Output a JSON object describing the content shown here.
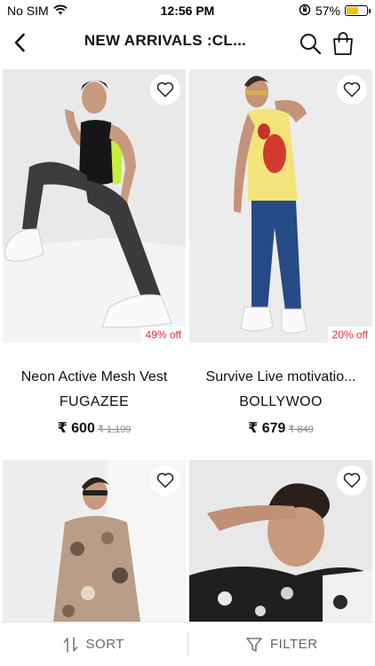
{
  "status_bar": {
    "carrier": "No SIM",
    "time": "12:56 PM",
    "battery": "57%",
    "battery_level": 0.57
  },
  "header": {
    "title": "NEW ARRIVALS :CL..."
  },
  "products": [
    {
      "name": "Neon Active Mesh Vest",
      "brand": "FUGAZEE",
      "price": "₹ 600",
      "mrp": "₹ 1,199",
      "discount": "49% off"
    },
    {
      "name": "Survive Live motivatio...",
      "brand": "BOLLYWOO",
      "price": "₹ 679",
      "mrp": "₹ 849",
      "discount": "20% off"
    },
    {},
    {}
  ],
  "bottom_bar": {
    "sort_label": "SORT",
    "filter_label": "FILTER"
  },
  "colors": {
    "discount": "#e0303a",
    "battery": "#f5c400"
  }
}
